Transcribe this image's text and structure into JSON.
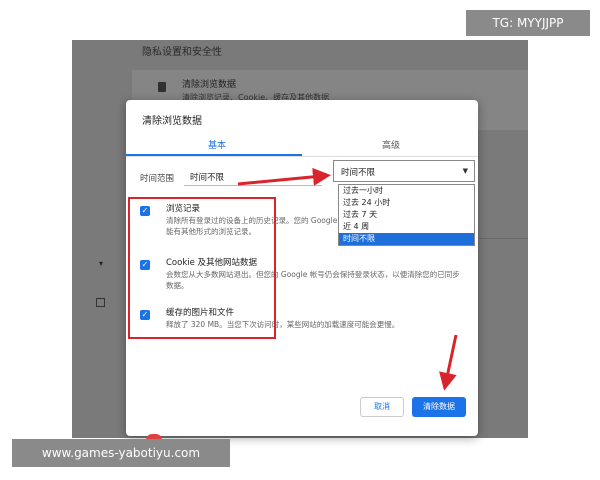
{
  "background_page": {
    "section_title": "隐私设置和安全性",
    "item_title": "清除浏览数据",
    "item_subtitle": "清除浏览记录、Cookie、缓存及其他数据"
  },
  "dialog": {
    "title": "清除浏览数据",
    "tabs": [
      {
        "label": "基本"
      },
      {
        "label": "高级"
      }
    ],
    "time_range_label": "时间范围",
    "time_range_value": "时间不限",
    "items": [
      {
        "title": "浏览记录",
        "desc": "清除所有登录过的设备上的历史记录。您的 Google 帐号 myactivity.google.com 上可能有其他形式的浏览记录。"
      },
      {
        "title": "Cookie 及其他网站数据",
        "desc": "会数您从大多数网站退出。但您的 Google 帐号仍会保持登录状态，以便清除您的已同步数据。"
      },
      {
        "title": "缓存的图片和文件",
        "desc": "释放了 320 MB。当您下次访问时，某些网站的加载速度可能会更慢。"
      }
    ],
    "cancel_label": "取消",
    "clear_label": "清除数据"
  },
  "dropdown": {
    "value": "时间不限",
    "options": [
      "过去一小时",
      "过去 24 小时",
      "过去 7 天",
      "近 4 周",
      "时间不限"
    ],
    "selected_index": 4
  },
  "watermarks": {
    "top": "TG: MYYJJPP",
    "bottom": "www.games-yabotiyu.com"
  },
  "colors": {
    "accent": "#1a73e8",
    "annotation": "#d9242b"
  }
}
